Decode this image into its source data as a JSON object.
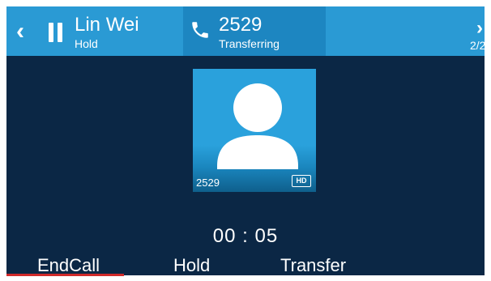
{
  "header": {
    "held_call": {
      "name": "Lin Wei",
      "status": "Hold"
    },
    "active_call": {
      "number": "2529",
      "status": "Transferring"
    },
    "page_indicator": "2/2"
  },
  "contact": {
    "number": "2529",
    "hd_badge": "HD"
  },
  "call_timer": "00 : 05",
  "softkeys": {
    "endcall": "EndCall",
    "hold": "Hold",
    "transfer": "Transfer"
  },
  "icons": {
    "back": "chevron-left-icon",
    "held": "pause-icon",
    "active": "phone-icon",
    "next": "chevron-right-icon",
    "avatar": "contact-silhouette-icon"
  },
  "colors": {
    "background": "#0b2745",
    "header": "#2a9ad4",
    "active_header": "#1d86c1",
    "avatar": "#2aa1dc",
    "accent_red": "#d12a2a"
  }
}
